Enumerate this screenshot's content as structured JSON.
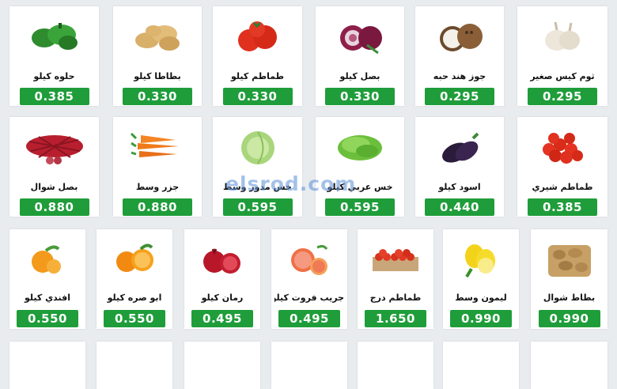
{
  "watermark": "elsrod.com",
  "accent_color": "#1f9d3a",
  "rows": [
    [
      {
        "name": "حلوه كيلو",
        "price": "0.385",
        "icon": "green-pepper-icon"
      },
      {
        "name": "بطاطا كيلو",
        "price": "0.330",
        "icon": "potato-icon"
      },
      {
        "name": "طماطم كيلو",
        "price": "0.330",
        "icon": "tomato-icon"
      },
      {
        "name": "بصل كيلو",
        "price": "0.330",
        "icon": "red-onion-icon"
      },
      {
        "name": "جوز هند حبه",
        "price": "0.295",
        "icon": "coconut-icon"
      },
      {
        "name": "ثوم كيس صغير",
        "price": "0.295",
        "icon": "garlic-icon"
      }
    ],
    [
      {
        "name": "بصل شوال",
        "price": "0.880",
        "icon": "onion-sack-icon"
      },
      {
        "name": "جزر وسط",
        "price": "0.880",
        "icon": "carrot-icon"
      },
      {
        "name": "خس مدور وسط",
        "price": "0.595",
        "icon": "cabbage-icon"
      },
      {
        "name": "خس عربي كيلو",
        "price": "0.595",
        "icon": "lettuce-icon"
      },
      {
        "name": "اسود كيلو",
        "price": "0.440",
        "icon": "eggplant-icon"
      },
      {
        "name": "طماطم شيري",
        "price": "0.385",
        "icon": "cherry-tomato-icon"
      }
    ],
    [
      {
        "name": "افندي كيلو",
        "price": "0.550",
        "icon": "tangerine-icon"
      },
      {
        "name": "ابو صره كيلو",
        "price": "0.550",
        "icon": "orange-icon"
      },
      {
        "name": "رمان كيلو",
        "price": "0.495",
        "icon": "pomegranate-icon"
      },
      {
        "name": "جريب فروت كيلو",
        "price": "0.495",
        "icon": "grapefruit-icon"
      },
      {
        "name": "طماطم درج",
        "price": "1.650",
        "icon": "tomato-crate-icon"
      },
      {
        "name": "ليمون وسط",
        "price": "0.990",
        "icon": "lemon-icon"
      },
      {
        "name": "بطاط شوال",
        "price": "0.990",
        "icon": "potato-sack-icon"
      }
    ]
  ]
}
